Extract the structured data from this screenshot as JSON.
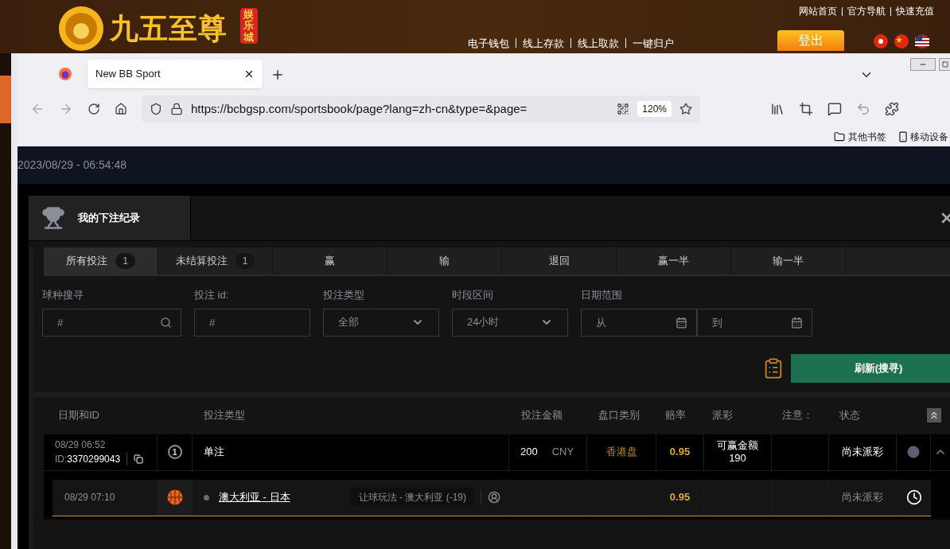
{
  "site": {
    "logo_text": "九五至尊",
    "logo_badge": "娱乐城",
    "top_links": [
      "网站首页",
      "官方导航",
      "快速充值"
    ],
    "nav_links": [
      "电子钱包",
      "线上存款",
      "线上取款",
      "一键归户"
    ],
    "logout": "登出"
  },
  "browser": {
    "tab_title": "New BB Sport",
    "url": "https://bcbgsp.com/sportsbook/page?lang=zh-cn&type=&page=",
    "zoom": "120%",
    "bookmarks": [
      "其他书签",
      "移动设备"
    ]
  },
  "page": {
    "datetime": "2023/08/29 - 06:54:48"
  },
  "panel": {
    "title": "我的下注纪录",
    "tabs": [
      {
        "label": "所有投注",
        "count": "1",
        "selected": true
      },
      {
        "label": "未结算投注",
        "count": "1",
        "selected": false
      },
      {
        "label": "赢",
        "selected": false
      },
      {
        "label": "输",
        "selected": false
      },
      {
        "label": "退回",
        "selected": false
      },
      {
        "label": "赢一半",
        "selected": false
      },
      {
        "label": "输一半",
        "selected": false
      }
    ],
    "filters": [
      {
        "kind": "search",
        "label": "球种搜寻",
        "placeholder": "#"
      },
      {
        "kind": "text",
        "label": "投注 id:",
        "placeholder": "#"
      },
      {
        "kind": "select",
        "label": "投注类型",
        "value": "全部"
      },
      {
        "kind": "select",
        "label": "时段区间",
        "value": "24小时"
      },
      {
        "kind": "daterange",
        "label": "日期范围",
        "fields": [
          {
            "placeholder": "从"
          },
          {
            "placeholder": "到"
          }
        ]
      }
    ],
    "refresh_button": "刷新(搜寻)",
    "columns": [
      "日期和ID",
      "投注类型",
      "投注金额",
      "盘口类别",
      "赔率",
      "派彩",
      "注意：",
      "状态"
    ],
    "bets": [
      {
        "date": "08/29 06:52",
        "id_label": "ID:",
        "id": "3370299043",
        "number": "1",
        "type": "单注",
        "amount": "200",
        "currency": "CNY",
        "market": "香港盘",
        "odds": "0.95",
        "payout_label": "可赢金额",
        "payout": "190",
        "status": "尚未派彩",
        "expanded": true,
        "legs": [
          {
            "date": "08/29 07:10",
            "match": "澳大利亚 - 日本",
            "bet": "让球玩法 - 澳大利亚 (-19)",
            "odds": "0.95",
            "status": "尚未派彩"
          }
        ]
      }
    ]
  }
}
